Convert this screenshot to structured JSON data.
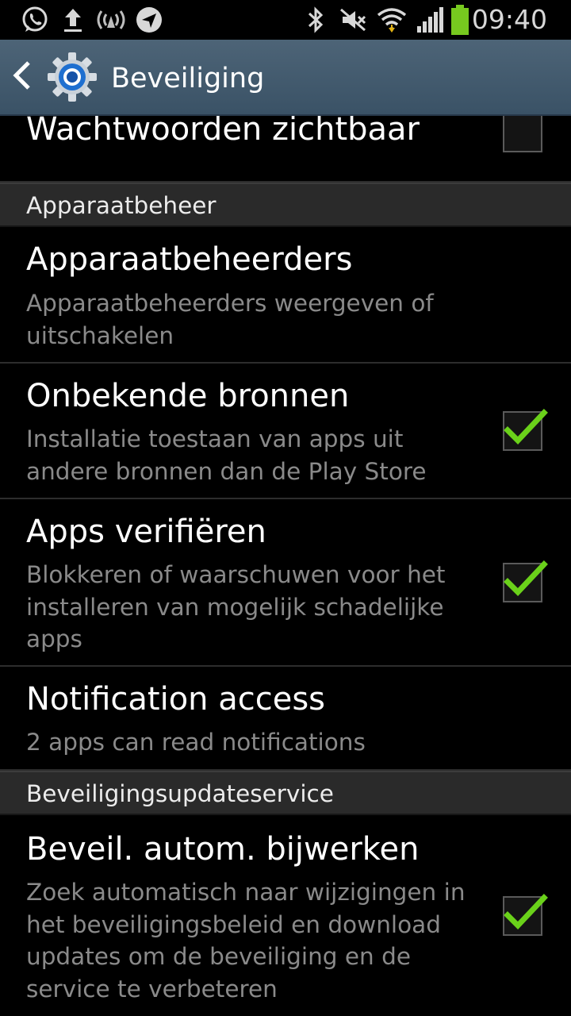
{
  "status_bar": {
    "time": "09:40",
    "left_icons": [
      "whatsapp-icon",
      "upload-icon",
      "wireless-icon",
      "navigation-icon"
    ],
    "right_icons": [
      "bluetooth-icon",
      "mute-icon",
      "wifi-icon",
      "signal-icon",
      "battery-icon"
    ]
  },
  "action_bar": {
    "title": "Beveiliging",
    "back_icon": "chevron-left-icon",
    "app_icon": "settings-gear-icon"
  },
  "items": {
    "passwords_visible": {
      "title": "Wachtwoorden zichtbaar",
      "checked": false
    },
    "device_admin_header": "Apparaatbeheer",
    "device_admins": {
      "title": "Apparaatbeheerders",
      "summary": "Apparaatbeheerders weergeven of\nuitschakelen"
    },
    "unknown_sources": {
      "title": "Onbekende bronnen",
      "summary": "Installatie toestaan van apps uit\nandere bronnen dan de Play Store",
      "checked": true
    },
    "verify_apps": {
      "title": "Apps verifiëren",
      "summary": "Blokkeren of waarschuwen voor het\ninstalleren van mogelijk schadelijke\napps",
      "checked": true
    },
    "notification_access": {
      "title": "Notification access",
      "summary": "2 apps can read notifications"
    },
    "security_update_header": "Beveiligingsupdateservice",
    "auto_update": {
      "title": "Beveil. autom. bijwerken",
      "summary": "Zoek automatisch naar wijzigingen in\nhet beveiligingsbeleid en download\nupdates om de beveiliging en de\nservice te verbeteren",
      "checked": true
    }
  },
  "colors": {
    "action_bar": "#3d5569",
    "check_mark": "#6ad11a",
    "summary_text": "#8a8a8a",
    "section_header_bg": "#2a2a2a"
  }
}
